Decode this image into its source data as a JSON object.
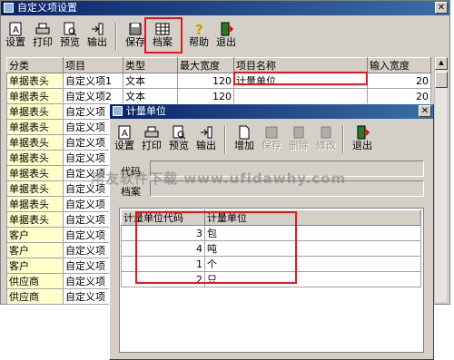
{
  "main_window": {
    "title": "自定义项设置",
    "toolbar": [
      "设置",
      "打印",
      "预览",
      "输出",
      "保存",
      "档案",
      "帮助",
      "退出"
    ],
    "columns": [
      "分类",
      "项目",
      "类型",
      "最大宽度",
      "项目名称",
      "输入宽度"
    ],
    "rows": [
      [
        "单据表头",
        "自定义项1",
        "文本",
        "120",
        "计量单位",
        "20"
      ],
      [
        "单据表头",
        "自定义项2",
        "文本",
        "120",
        "",
        "20"
      ],
      [
        "单据表头",
        "自定义项",
        "",
        "",
        "",
        ""
      ],
      [
        "单据表头",
        "自定义项",
        "",
        "",
        "",
        ""
      ],
      [
        "单据表头",
        "自定义项",
        "",
        "",
        "",
        ""
      ],
      [
        "单据表头",
        "自定义项",
        "",
        "",
        "",
        ""
      ],
      [
        "单据表头",
        "自定义项",
        "",
        "",
        "",
        ""
      ],
      [
        "单据表头",
        "自定义项",
        "",
        "",
        "",
        ""
      ],
      [
        "单据表头",
        "自定义项",
        "",
        "",
        "",
        ""
      ],
      [
        "单据表头",
        "自定义项",
        "",
        "",
        "",
        ""
      ],
      [
        "客户",
        "自定义项",
        "",
        "",
        "",
        ""
      ],
      [
        "客户",
        "自定义项",
        "",
        "",
        "",
        ""
      ],
      [
        "客户",
        "自定义项",
        "",
        "",
        "",
        ""
      ],
      [
        "供应商",
        "自定义项",
        "",
        "",
        "",
        ""
      ],
      [
        "供应商",
        "自定义项",
        "",
        "",
        "",
        ""
      ]
    ]
  },
  "dialog": {
    "title": "计量单位",
    "toolbar": [
      "设置",
      "打印",
      "预览",
      "输出",
      "增加",
      "保存",
      "删除",
      "修改",
      "退出"
    ],
    "code_label": "代码",
    "archive_label": "档案",
    "columns": [
      "计量单位代码",
      "计量单位"
    ],
    "rows": [
      [
        "3",
        "包"
      ],
      [
        "4",
        "吨"
      ],
      [
        "1",
        "个"
      ],
      [
        "2",
        "只"
      ]
    ]
  },
  "watermark": "用友软件下载 www.ufidawhy.com",
  "colors": {
    "highlight": "#e8141e",
    "title_bar": "#0a246a",
    "category_bg": "#ffffcc"
  }
}
